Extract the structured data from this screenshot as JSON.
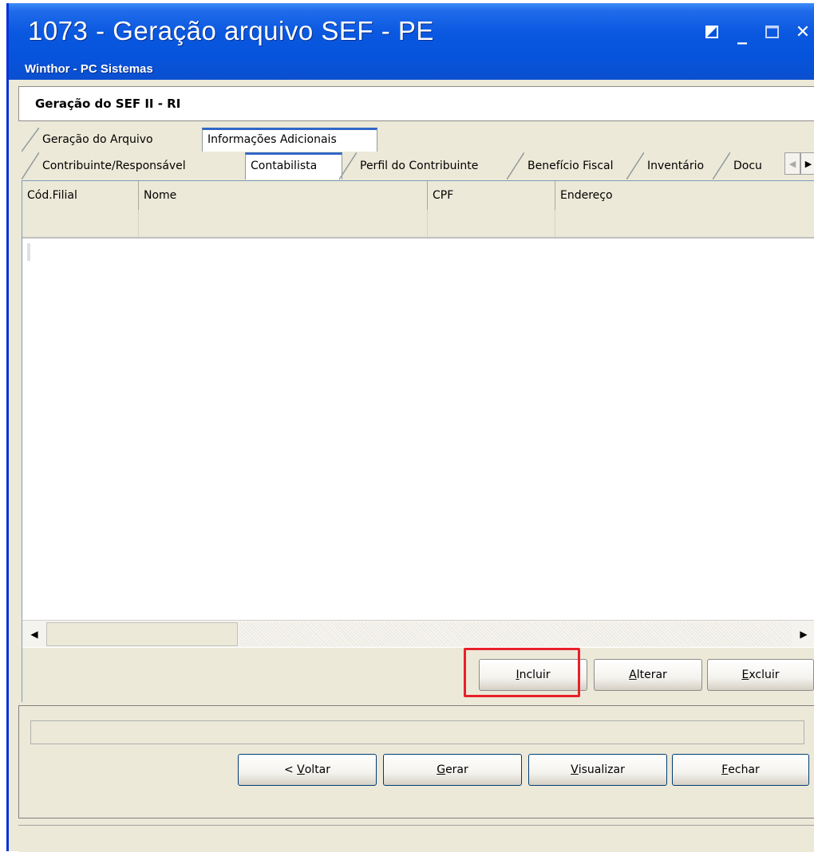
{
  "window": {
    "title": "1073 - Geração arquivo SEF - PE",
    "subtitle": "Winthor - PC Sistemas",
    "controls": [
      "restore-icon",
      "minimize-icon",
      "maximize-icon",
      "close-icon"
    ],
    "close_glyph": "✕",
    "minimize_glyph": "_"
  },
  "header": {
    "title": "Geração do SEF II - RI"
  },
  "tabs_top": [
    {
      "label": "Geração do Arquivo",
      "active": false
    },
    {
      "label": "Informações Adicionais",
      "active": true
    }
  ],
  "tabs_sub": [
    {
      "label": "Contribuinte/Responsável",
      "active": false
    },
    {
      "label": "Contabilista",
      "active": true
    },
    {
      "label": "Perfil do Contribuinte",
      "active": false
    },
    {
      "label": "Benefício Fiscal",
      "active": false
    },
    {
      "label": "Inventário",
      "active": false
    },
    {
      "label": "Docu",
      "active": false
    }
  ],
  "grid": {
    "columns": [
      "Cód.Filial",
      "Nome",
      "CPF",
      "Endereço"
    ],
    "rows": []
  },
  "grid_buttons": {
    "incluir_prefix": "",
    "incluir_u": "I",
    "incluir_rest": "ncluir",
    "alterar_u": "A",
    "alterar_rest": "lterar",
    "excluir_u": "E",
    "excluir_rest": "xcluir"
  },
  "footer_buttons": {
    "voltar_prefix": "< ",
    "voltar_u": "V",
    "voltar_rest": "oltar",
    "gerar_u": "G",
    "gerar_rest": "erar",
    "visualizar_u": "V",
    "visualizar_rest": "isualizar",
    "fechar_u": "F",
    "fechar_rest": "echar"
  },
  "colors": {
    "titlebar": "#0654dc",
    "highlight": "#e8202a",
    "active_tab": "#3167c6"
  }
}
